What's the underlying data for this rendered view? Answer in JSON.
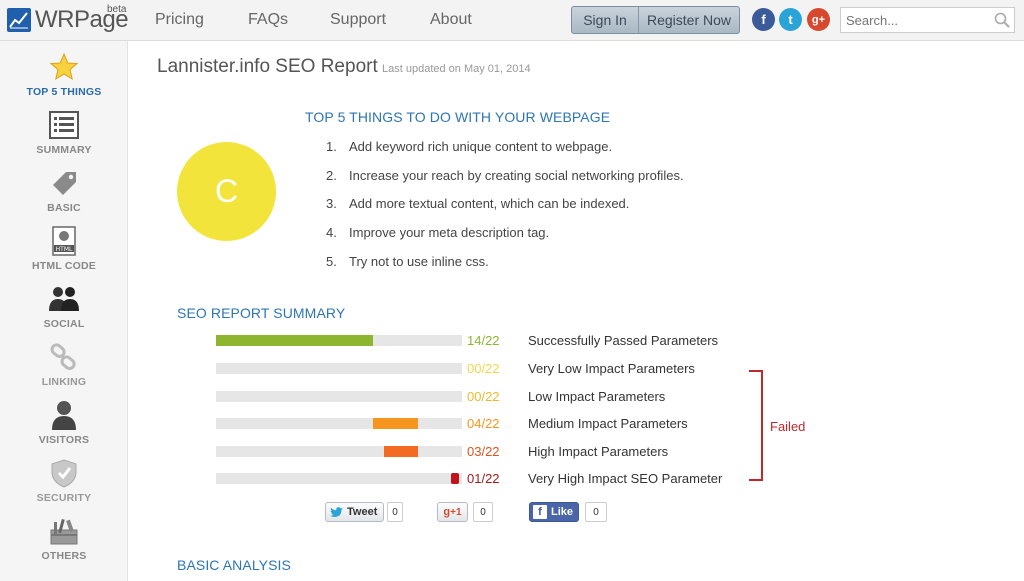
{
  "header": {
    "logo_text": "WRPage",
    "logo_badge": "beta",
    "nav": [
      "Pricing",
      "FAQs",
      "Support",
      "About"
    ],
    "sign_in_label": "Sign In",
    "register_label": "Register Now",
    "social": [
      {
        "icon": "facebook-icon",
        "glyph": "f"
      },
      {
        "icon": "twitter-icon",
        "glyph": "t"
      },
      {
        "icon": "google-plus-icon",
        "glyph": "g+"
      }
    ],
    "search_placeholder": "Search..."
  },
  "sidebar": {
    "items": [
      {
        "label": "TOP 5 THINGS",
        "icon": "star-icon",
        "active": true
      },
      {
        "label": "SUMMARY",
        "icon": "list-icon"
      },
      {
        "label": "BASIC",
        "icon": "tag-icon"
      },
      {
        "label": "HTML CODE",
        "icon": "html-file-icon"
      },
      {
        "label": "SOCIAL",
        "icon": "people-icon"
      },
      {
        "label": "LINKING",
        "icon": "chain-link-icon"
      },
      {
        "label": "VISITORS",
        "icon": "visitor-icon"
      },
      {
        "label": "SECURITY",
        "icon": "shield-icon"
      },
      {
        "label": "OTHERS",
        "icon": "tools-icon"
      }
    ]
  },
  "report": {
    "title": "Lannister.info SEO Report",
    "updated": "Last updated on May 01, 2014",
    "grade": "C",
    "top5_heading": "TOP 5 THINGS TO DO WITH YOUR WEBPAGE",
    "top5": [
      {
        "num": "1.",
        "text": "Add keyword rich unique content to webpage."
      },
      {
        "num": "2.",
        "text": "Increase your reach by creating social networking profiles."
      },
      {
        "num": "3.",
        "text": "Add more textual content, which can be indexed."
      },
      {
        "num": "4.",
        "text": "Improve your meta description tag."
      },
      {
        "num": "5.",
        "text": "Try not to use inline css."
      }
    ],
    "summary_heading": "SEO REPORT SUMMARY",
    "summary": [
      {
        "ratio": "14/22",
        "label": "Successfully Passed Parameters",
        "value": 14,
        "total": 22,
        "color": "#8db52f",
        "ratio_color": "#8db52f"
      },
      {
        "ratio": "00/22",
        "label": "Very Low Impact Parameters",
        "value": 0,
        "total": 22,
        "color": "#f2d64a",
        "ratio_color": "#f2d64a"
      },
      {
        "ratio": "00/22",
        "label": "Low Impact Parameters",
        "value": 0,
        "total": 22,
        "color": "#f2c23a",
        "ratio_color": "#f0b92c"
      },
      {
        "ratio": "04/22",
        "label": "Medium Impact Parameters",
        "value": 4,
        "total": 22,
        "color": "#f7961e",
        "ratio_color": "#f7961e"
      },
      {
        "ratio": "03/22",
        "label": "High Impact Parameters",
        "value": 3,
        "total": 22,
        "color": "#f36a22",
        "ratio_color": "#e0541c"
      },
      {
        "ratio": "01/22",
        "label": "Very High Impact SEO Parameter",
        "value": 1,
        "total": 22,
        "color": "#c0131b",
        "ratio_color": "#a51a1a"
      }
    ],
    "failed_label": "Failed",
    "share": {
      "tweet_label": "Tweet",
      "tweet_count": "0",
      "gplus_label": "+1",
      "gplus_count": "0",
      "like_label": "Like",
      "like_count": "0"
    },
    "basic_heading": "BASIC ANALYSIS"
  }
}
